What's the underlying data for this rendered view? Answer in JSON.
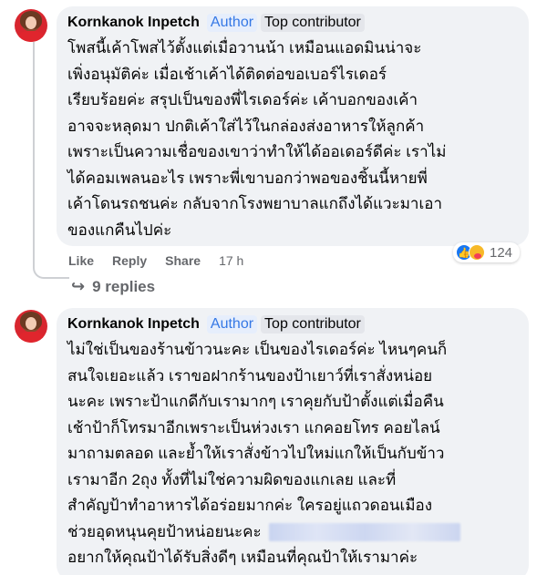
{
  "comments": [
    {
      "author": "Kornkanok Inpetch",
      "badge_author": "Author",
      "badge_top": "Top contributor",
      "text": "โพสนี้เค้าโพสไว้ตั้งแต่เมื่อวานน้า เหมือนแอดมินน่าจะ\nเพิ่งอนุมัติค่ะ เมื่อเช้าเค้าได้ติดต่อขอเบอร์ไรเดอร์\nเรียบร้อยค่ะ สรุปเป็นของพี่ไรเดอร์ค่ะ เค้าบอกของเค้า\nอาจจะหลุดมา ปกติเค้าใส่ไว้ในกล่องส่งอาหารให้ลูกค้า\nเพราะเป็นความเชื่อของเขาว่าทำให้ได้ออเดอร์ดีค่ะ เราไม่\nได้คอมเพลนอะไร เพราะพี่เขาบอกว่าพอของชิ้นนี้หายพี่\nเค้าโดนรถชนค่ะ กลับจากโรงพยาบาลแกถึงได้แวะมาเอา\nของแกคืนไปค่ะ",
      "actions": {
        "like": "Like",
        "reply": "Reply",
        "share": "Share",
        "time": "17 h"
      },
      "reaction_count": "124",
      "replies_label": "9 replies"
    },
    {
      "author": "Kornkanok Inpetch",
      "badge_author": "Author",
      "badge_top": "Top contributor",
      "text_lines": [
        "ไม่ใช่เป็นของร้านข้าวนะคะ เป็นของไรเดอร์ค่ะ ไหนๆคนก็",
        "สนใจเยอะแล้ว เราขอฝากร้านของป้าเยาว์ที่เราสั่งหน่อย",
        "นะคะ เพราะป้าแกดีกับเรามากๆ เราคุยกับป้าตั้งแต่เมื่อคืน",
        "เช้าป้าก็โทรมาอีกเพราะเป็นห่วงเรา แกคอยโทร คอยไลน์",
        "มาถามตลอด และย้ำให้เราสั่งข้าวไปใหม่แกให้เป็นกับข้าว",
        "เรามาอีก 2ถุง ทั้งที่ไม่ใช่ความผิดของแกเลย และที่",
        "สำคัญป้าทำอาหารได้อร่อยมากค่ะ ใครอยู่แถวดอนเมือง",
        "ช่วยอุดหนุนคุยป้าหน่อยนะคะ",
        "อยากให้คุณป้าได้รับสิ่งดีๆ เหมือนที่คุณป้าให้เรามาค่ะ"
      ]
    }
  ],
  "colors": {
    "bubble": "#f0f2f5",
    "author_badge": "#3578e5",
    "meta": "#65676b",
    "like": "#1877f2"
  },
  "icons": [
    "avatar",
    "like-reaction-icon",
    "care-reaction-icon",
    "reply-arrow-icon"
  ]
}
